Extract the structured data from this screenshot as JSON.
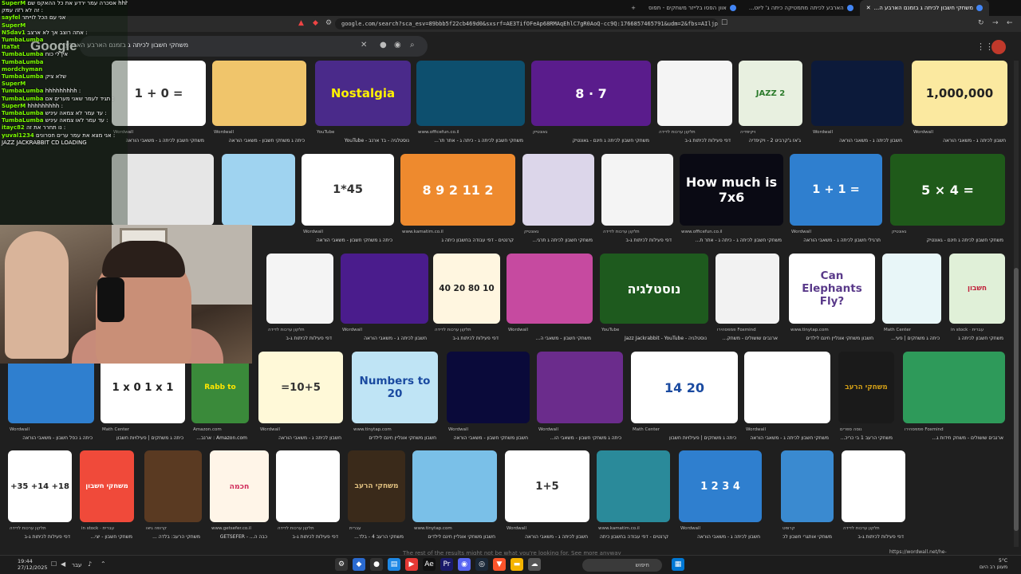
{
  "tabs": [
    {
      "label": "משחקי חשבון לכיתה ג בזמנם הארבע ה...",
      "active": true
    },
    {
      "label": "הארבע לכיתה מתמטיקה כיתה ג' ליוט...",
      "active": false
    },
    {
      "label": "אוון הפסו בלייזר משחקים - תפוס",
      "active": false
    }
  ],
  "address": {
    "url": "google.com/search?sca_esv=89bbb5f22cb469d0&sxsrf=AE3TifOFeAp68RMAqEhlC7gR0AoQ-cc9Q:1766857465791&udm=2&fbs=AIljpHxU7SXXniU..."
  },
  "google": {
    "logo": "Google",
    "query": "משחקי חשבון לכיתה ג בזמנם הארבע הארבע"
  },
  "chat": [
    {
      "user": "SuperM",
      "text": "אסכרה עמר ירדע את כל ההאקס שם hhhhhhhhh :"
    },
    {
      "user": "",
      "text": "זה לא רזה עמק :"
    },
    {
      "user": "sayfel",
      "text": "אני עם הכל לוייתר"
    },
    {
      "user": "SuperM",
      "text": ""
    },
    {
      "user": "N5dav1",
      "text": "אתה רוצב אך לא ארצב :"
    },
    {
      "user": "TumbaLumba",
      "text": ""
    },
    {
      "user": "ItaTat",
      "text": ""
    },
    {
      "user": "TumbaLumba",
      "text": "אין לי כוח"
    },
    {
      "user": "TumbaLumba",
      "text": ""
    },
    {
      "user": "mordchyman",
      "text": ""
    },
    {
      "user": "TumbaLumba",
      "text": "שלא ציק"
    },
    {
      "user": "SuperM",
      "text": ""
    },
    {
      "user": "TumbaLumba",
      "text": "hhhhhhhhh :"
    },
    {
      "user": "TumbaLumba",
      "text": "תגיד לעמר שאני מערים אם :"
    },
    {
      "user": "SuperM",
      "text": "hhhhhhhhh :"
    },
    {
      "user": "TumbaLumba",
      "text": "עד עמר לא צמאה עיניש :"
    },
    {
      "user": "TumbaLumba",
      "text": "עד עמר לאו צמאה עיניש :"
    },
    {
      "user": "",
      "text": ""
    },
    {
      "user": "",
      "text": ""
    },
    {
      "user": "",
      "text": ""
    },
    {
      "user": "",
      "text": ""
    },
    {
      "user": "itayc82",
      "text": "נו תחרר את זה :"
    },
    {
      "user": "yuval1234",
      "text": "אני מצא את עמר ערים חסרונים :"
    },
    {
      "user": "",
      "text": "JAZZ JACKRABBIT CD  LOADING"
    }
  ],
  "results": [
    {
      "src": "Wordwall",
      "cap": "משחקי חשבון לכיתה ג - משאבי הוראה",
      "text": "1 + 0 =",
      "bg": "#ffffff",
      "fg": "#333333"
    },
    {
      "src": "Wordwall",
      "cap": "כיתה ג משחקי חשבון - משאבי הוראה",
      "text": "",
      "bg": "#f0c56b",
      "fg": "#3f7fd0"
    },
    {
      "src": "YouTube",
      "cap": "נוסטלגיה - בד ארנב - YouTube",
      "text": "Nostalgia",
      "bg": "#4a2a8a",
      "fg": "#fff200"
    },
    {
      "src": "www.officefun.co.il",
      "cap": "משחקי חשבון לכיתה ג - כיתה ג - אתר תר...",
      "text": "",
      "bg": "#0d4f6e",
      "fg": "#ffffff"
    },
    {
      "src": "גאונטיק",
      "cap": "משחקי חשבון לכיתה ג חינם - גאונטיק",
      "text": "8 · 7",
      "bg": "#5a1c8c",
      "fg": "#ffffff"
    },
    {
      "src": "תלקון ערכות לדידה",
      "cap": "דפי פעילות לכיתות ג-ב",
      "text": "",
      "bg": "#f4f4f4",
      "fg": "#333333"
    },
    {
      "src": "ויקיפדיה",
      "cap": "ג'אז ג'קרביט 2 - ויקיפדיה",
      "text": "JAZZ 2",
      "bg": "#e8f0e0",
      "fg": "#2a7a2a"
    },
    {
      "src": "Wordwall",
      "cap": "חשבון לכיתה ג - משאבי הוראה",
      "text": "",
      "bg": "#0c1a3a",
      "fg": "#ff3355"
    },
    {
      "src": "Wordwall",
      "cap": "חשבון לכיתה ג - משאבי הוראה",
      "text": "1,000,000",
      "bg": "#fbe9a0",
      "fg": "#222222"
    },
    {
      "src": "",
      "cap": "",
      "text": "",
      "bg": "#e6e6e6",
      "fg": "#333333"
    },
    {
      "src": "",
      "cap": "",
      "text": "",
      "bg": "#9fd3f0",
      "fg": "#333333"
    },
    {
      "src": "Wordwall",
      "cap": "כיתה ג משחקי חשבון - משאבי הוראה",
      "text": "1*45",
      "bg": "#ffffff",
      "fg": "#333333"
    },
    {
      "src": "www.kamatim.co.il",
      "cap": "קרנטים - דפי עבודה בחשבון כיתה ג",
      "text": "8 9 2 11 2",
      "bg": "#ee8a2e",
      "fg": "#ffffff"
    },
    {
      "src": "גאונטיק",
      "cap": "משחקי חשבון לכיתה ג תרגי...",
      "text": "",
      "bg": "#dcd6ea",
      "fg": "#6b4f9e"
    },
    {
      "src": "תלקון ערכות לדידה",
      "cap": "דפי פעילות לכיתות ג-ב",
      "text": "",
      "bg": "#f4f4f4",
      "fg": "#333333"
    },
    {
      "src": "www.officefun.co.il",
      "cap": "משחקי חשבון לכיתה ג - כיתה ג - אתר ת...",
      "text": "How much is 7x6",
      "bg": "#0a0a14",
      "fg": "#ffffff"
    },
    {
      "src": "Wordwall",
      "cap": "תרגילי חשבון לכיתה ג - משאבי הוראה",
      "text": "1 + 1 =",
      "bg": "#2f7fcf",
      "fg": "#ffffff"
    },
    {
      "src": "גאונטיק",
      "cap": "משחקי חשבון לכיתה ג חינם - גאונטיק",
      "text": "5 × 4 =",
      "bg": "#1f5a1a",
      "fg": "#ffffff"
    },
    {
      "src": "תלקון ערכות לדידה",
      "cap": "דפי פעילות לכיתות ג-ב",
      "text": "",
      "bg": "#f4f4f4",
      "fg": "#333333"
    },
    {
      "src": "Wordwall",
      "cap": "חשבון לכיתה ג - משאבי הוראה",
      "text": "",
      "bg": "#4a1c8c",
      "fg": "#f5c542"
    },
    {
      "src": "תלקון ערכות לדידה",
      "cap": "דפי פעילות לכיתות ג-ב",
      "text": "40 20 80 10",
      "bg": "#fff6e0",
      "fg": "#222222"
    },
    {
      "src": "Wordwall",
      "cap": "משחקי חשבון - משאבי ה...",
      "text": "",
      "bg": "#c64aa0",
      "fg": "#ffffff"
    },
    {
      "src": "YouTube",
      "cap": "נוסטלגיה - Jazz Jackrabbit - YouTube",
      "text": "נוסטלגיה",
      "bg": "#1e5a1e",
      "fg": "#ffffff"
    },
    {
      "src": "פמפסהירו Foxmind",
      "cap": "ארנבים שושולים - משחק...",
      "text": "",
      "bg": "#f2f2f2",
      "fg": "#2a8a3a"
    },
    {
      "src": "www.tinytap.com",
      "cap": "חשבון משחקי אונליין חינם לילדים",
      "text": "Can Elephants Fly?",
      "bg": "#ffffff",
      "fg": "#5a3a8a"
    },
    {
      "src": "Math Center",
      "cap": "כיתה ג משחקים | פעי...",
      "text": "",
      "bg": "#e8f6f8",
      "fg": "#2a8a9a"
    },
    {
      "src": "in stock · עברית",
      "cap": "משחקי חשבון לכיתה ג",
      "text": "חשבון",
      "bg": "#e0f0d8",
      "fg": "#c0203a"
    },
    {
      "src": "Wordwall",
      "cap": "כיתה ג כפל חשבון - משאבי הוראה",
      "text": "",
      "bg": "#2f7fcf",
      "fg": "#ffffff"
    },
    {
      "src": "Math Center",
      "cap": "כיתה ג משחקים | פעילויות חשבון",
      "text": "1 x 0   1 x 1",
      "bg": "#ffffff",
      "fg": "#222222"
    },
    {
      "src": "Amazon.com",
      "cap": "Amazon.com : ארנב...",
      "text": "Rabb to",
      "bg": "#3a8a3a",
      "fg": "#ffe600"
    },
    {
      "src": "Wordwall",
      "cap": "חשבון לכיתה ג - משאבי הוראה",
      "text": "=10+5",
      "bg": "#fff9d8",
      "fg": "#333333"
    },
    {
      "src": "www.tinytap.com",
      "cap": "חשבון משחקי אונליין חינם לילדים",
      "text": "Numbers to 20",
      "bg": "#bfe4f5",
      "fg": "#1a4aa0"
    },
    {
      "src": "Wordwall",
      "cap": "חשבון משחקי חשבון - משאבי הוראה",
      "text": "",
      "bg": "#0a0a3a",
      "fg": "#f5d000"
    },
    {
      "src": "Wordwall",
      "cap": "כיתה ג משחקי חשבון - משאבי הו...",
      "text": "",
      "bg": "#6b2c8c",
      "fg": "#ffffff"
    },
    {
      "src": "Math Center",
      "cap": "כיתה ג משחקים | פעילויות חשבון",
      "text": "14    20",
      "bg": "#ffffff",
      "fg": "#1a4aa0"
    },
    {
      "src": "Wordwall",
      "cap": "משחקי חשבון לכיתה ג - משאבי הוראה",
      "text": "",
      "bg": "#ffffff",
      "fg": "#333333"
    },
    {
      "src": "נוסה ספרים",
      "cap": "משחקי הרעב 1 בי כריכ...",
      "text": "משחקי הרעב",
      "bg": "#1a1a1a",
      "fg": "#d4a017"
    },
    {
      "src": "פמפסהירו Foxmind",
      "cap": "ארנבים שושולים - משחק חידות ג...",
      "text": "",
      "bg": "#2e9a5a",
      "fg": "#ffffff"
    },
    {
      "src": "תלקון ערכות לדידה",
      "cap": "דפי פעילות לכיתות ג-ב",
      "text": "+35 +14 +18",
      "bg": "#ffffff",
      "fg": "#222222"
    },
    {
      "src": "in stock · עברית",
      "cap": "משחקי חשבון - יצי...",
      "text": "משחקי חשבון",
      "bg": "#f04a3a",
      "fg": "#ffffff"
    },
    {
      "src": "קרופה גיאו",
      "cap": "משחקי הרעב: בלדה ...",
      "text": "",
      "bg": "#5a3a22",
      "fg": "#f5c542"
    },
    {
      "src": "www.getsefer.co.il",
      "cap": "כבה ה... - GETSEFER",
      "text": "חכמה",
      "bg": "#fff5e8",
      "fg": "#d02a5a"
    },
    {
      "src": "תלקון ערכות לדידה",
      "cap": "דפי פעילות לכיתות ג-ב",
      "text": "",
      "bg": "#ffffff",
      "fg": "#f0c030"
    },
    {
      "src": "עברית",
      "cap": "משחקי הרעב 4 - בלד...",
      "text": "משחקי הרעב",
      "bg": "#3a2a1a",
      "fg": "#e0c080"
    },
    {
      "src": "www.tinytap.com",
      "cap": "חשבון משחקי אונליין חינם לילדים",
      "text": "",
      "bg": "#7ac0e8",
      "fg": "#ffffff"
    },
    {
      "src": "Wordwall",
      "cap": "חשבון לכיתה ג - משאבי הוראה",
      "text": "1+5",
      "bg": "#ffffff",
      "fg": "#333333"
    },
    {
      "src": "www.kamatim.co.il",
      "cap": "קרנטים - דפי עבודה בחשבון כיתה ג",
      "text": "",
      "bg": "#2a8a9a",
      "fg": "#ffffff"
    },
    {
      "src": "Wordwall",
      "cap": "חשבון לכיתה ג - משאבי הוראה",
      "text": "1 2 3 4",
      "bg": "#2f7fcf",
      "fg": "#ffffff"
    },
    {
      "src": "קרופט",
      "cap": "משחקי אותגרי חשבון לכ...",
      "text": "",
      "bg": "#3a8ad0",
      "fg": "#ffffff"
    },
    {
      "src": "תלקון ערכות לדידה",
      "cap": "דפי פעילות לכיתות ג-ב",
      "text": "",
      "bg": "#ffffff",
      "fg": "#333333"
    }
  ],
  "status_url": "https://wordwall.net/he-il/community/כיתה-ג-משחקי-חשבון",
  "more_results": "The rest of the results might not be what you're looking for. See more anyway",
  "taskbar": {
    "time": "19:44",
    "date": "27/12/2025",
    "lang": "עבר",
    "search_placeholder": "חיפוש",
    "weather_temp": "5°C",
    "weather_desc": "מעונן רב היום"
  }
}
